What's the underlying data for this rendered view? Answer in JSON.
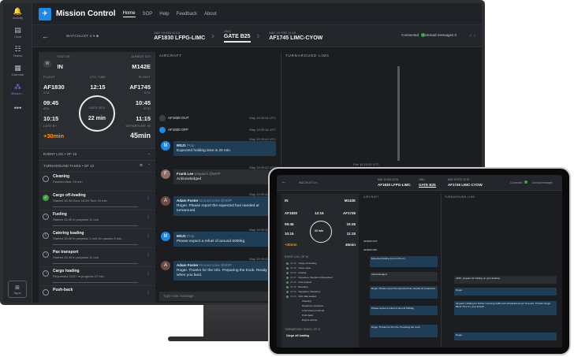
{
  "rail": [
    {
      "label": "Activity",
      "icon": "bell-icon"
    },
    {
      "label": "Chat",
      "icon": "chat-icon"
    },
    {
      "label": "Teams",
      "icon": "teams-icon"
    },
    {
      "label": "Calendar",
      "icon": "calendar-icon"
    },
    {
      "label": "Mission...",
      "icon": "mission-icon"
    },
    {
      "label": "",
      "icon": "more-icon"
    }
  ],
  "rail_apps": "Apps",
  "nav": {
    "title": "Mission Control",
    "links": [
      "Home",
      "SOP",
      "Help",
      "Feedback",
      "About"
    ]
  },
  "subbar": {
    "watchlist": "WATCHLIST",
    "watch_count": "4",
    "inbound": {
      "small": "MAY 19  ATA 10:15",
      "big": "AF1830 LFPG-LIMC"
    },
    "gate": {
      "small": "LIMC",
      "big": "GATE B25"
    },
    "outbound": {
      "small": "MAY 19  STD 11:15",
      "big": "AF1745 LIMC-CYOW"
    },
    "connected": "Connected",
    "unread": "Unread messages",
    "unread_count": "0"
  },
  "summary": {
    "status_label": "STATUS",
    "status": "IN",
    "status_badge": "W",
    "airbus_label": "AIRBUS 319",
    "airbus": "M142E",
    "flight_in_label": "FLIGHT",
    "flight_in": "AF1830",
    "utc_label": "UTC TIME",
    "utc": "12:15",
    "flight_out_label": "FLIGHT",
    "flight_out": "AF1745",
    "sta_label": "STA",
    "sta": "09:45",
    "std_label": "STD",
    "std": "10:45",
    "ata_label": "ATA",
    "ata": "10:15",
    "etd_label": "ETD",
    "etd": "11:15",
    "gate_label": "GATE B25",
    "gate_time": "22 min",
    "late_label": "LATE BY",
    "late": "+30min",
    "departure_label": "DEPARTURE IN",
    "departure": "45min"
  },
  "event_log": "EVENT LOG  •  OF 15",
  "tasks_header": "TURNAROUND TASKS  •  OF 12",
  "tasks": [
    {
      "name": "Cleaning",
      "sub": "Planned time: 15 min",
      "done": false
    },
    {
      "name": "Cargo off-loading",
      "sub": "Started 15:49  Done 15:59  Time 15 min",
      "done": true
    },
    {
      "name": "Fueling",
      "sub": "Started 15:49  In progress 11 min",
      "done": false
    },
    {
      "name": "Catering loading",
      "sub": "Started 15:49  In progress 1 min  On pauses 5 min",
      "done": false
    },
    {
      "name": "Pax transport",
      "sub": "Started 15:49  In progress 11 min",
      "done": false
    },
    {
      "name": "Cargo loading",
      "sub": "Requested 15:07  In progress 17 min",
      "done": false
    },
    {
      "name": "Push-back",
      "sub": "",
      "done": false
    }
  ],
  "columns": {
    "aircraft": "AIRCRAFT",
    "turnaround": "TURNAROUND LIMC"
  },
  "events": [
    {
      "label": "AF1830 OUT",
      "time": "May 19  09:04 UTC"
    },
    {
      "label": "AF1830 OFF",
      "time": "May 19  09:16 UTC"
    }
  ],
  "messages": [
    {
      "time": "May 19  09:43 UTC",
      "who": "MSJ1",
      "role": "Prop",
      "text": "Expected holding time is 20 min.",
      "avatar": "M",
      "color": "#1e88e5",
      "plain": false
    },
    {
      "time": "May 19  09:42 UTC",
      "who": "Frank Lee",
      "role": "Dispatch @MXP",
      "text": "Acknowledged",
      "avatar": "F",
      "color": "#8d6e63",
      "plain": true
    },
    {
      "time": "May 19  09:42 UTC",
      "who": "Adam Foster",
      "role": "Ground crew @MXP",
      "text": "Roger. Please report the expected fuel needed at turnaround.",
      "avatar": "A",
      "color": "#6d4c41",
      "plain": false
    },
    {
      "time": "May 19  09:42 UTC",
      "who": "MSJ1",
      "role": "Prop",
      "text": "Please expect a refuel of around 6000kg",
      "avatar": "M",
      "color": "#1e88e5",
      "plain": false
    },
    {
      "time": "May 19  09:42 UTC",
      "who": "Adam Foster",
      "role": "Ground crew @MXP",
      "text": "Roger. Thanks for the info. Preparing the truck. Ready when you land.",
      "avatar": "A",
      "color": "#6d4c41",
      "plain": false
    }
  ],
  "input_placeholder": "Type new message",
  "turn_time": "Feb 15  10:20 UTC",
  "tablet": {
    "inbound": {
      "small": "MAY 19  ATA 10:15",
      "big": "AF1830 LFPG-LIMC"
    },
    "gate": {
      "small": "LIMC",
      "big": "GATE B25"
    },
    "outbound": {
      "small": "MAY 19  STD 11:15",
      "big": "AF1745 LIMC-CYOW"
    },
    "connected": "Connected",
    "unread": "Unread messages",
    "watchlist": "WATCHLIST",
    "watch_count": "4",
    "aircraft": "AIRCRAFT",
    "turnaround": "TURNAROUND LIMC",
    "status": "IN",
    "airbus": "M142E",
    "flight_in": "AF1830",
    "utc": "12:15",
    "flight_out": "AF1745",
    "sta": "09:45",
    "std": "10:45",
    "ata": "10:15",
    "etd": "11:15",
    "late": "+30min",
    "departure": "45min",
    "gate_time": "22 min",
    "event_log": "EVENT LOG  •  OF 15",
    "tasks_header": "TURNAROUND TASKS  •  OF 12",
    "rows": [
      {
        "t": "15:40",
        "label": "Cargo off-loading"
      },
      {
        "t": "15:46",
        "label": "Clean close"
      },
      {
        "t": "15:46",
        "label": "Fueling"
      },
      {
        "t": "15:47",
        "label": "Departure Clearance Requested"
      },
      {
        "t": "15:48",
        "label": "Fuel request"
      },
      {
        "t": "15:48",
        "label": "Boarding"
      },
      {
        "t": "15:48",
        "label": "Departure Clearance"
      },
      {
        "t": "15:49",
        "label": "PAX data loaded"
      },
      {
        "t": "",
        "label": "Cleaning"
      },
      {
        "t": "",
        "label": "Departure clearance"
      },
      {
        "t": "",
        "label": "Load sheet produced"
      },
      {
        "t": "",
        "label": "Push-back"
      },
      {
        "t": "",
        "label": "Engine startup"
      }
    ],
    "last_task": "Cargo off-loading",
    "events": [
      "AF1830 OUT",
      "AF1830 OFF"
    ],
    "msgs_left": [
      "Expected holding time is 20 min.",
      "Acknowledged",
      "Roger. Please report the expected fuel needed at turnaround.",
      "Please expect a refuel of around 6000kg",
      "Roger. Thanks for the info. Preparing the truck."
    ],
    "msgs_right": [
      "LIMC, prepare for holding on your location.",
      "Roger.",
      "All good. Holding for further incoming traffic and scheduled as per time-slot. Provide Target Block Time for your aircraft.",
      "Roger."
    ]
  }
}
